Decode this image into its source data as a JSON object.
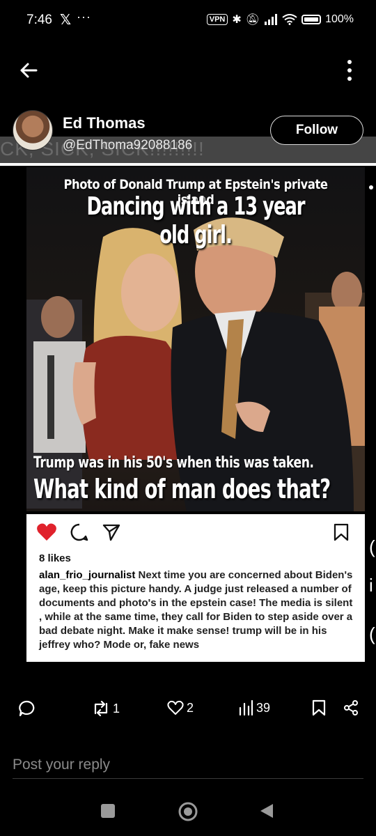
{
  "status_bar": {
    "time": "7:46",
    "notification_icon": "x-logo-icon",
    "overflow": "···",
    "vpn": "VPN",
    "battery": "100%"
  },
  "post": {
    "author_name": "Ed Thomas",
    "author_handle": "@EdThoma92088186",
    "follow_label": "Follow",
    "overlay_caption": "CK, SICK, SICK!!!!!!!!!"
  },
  "image": {
    "headline_small": "Photo of Donald Trump at Epstein's private island",
    "headline_large": "Dancing with a 13 year old girl.",
    "caption_line1": "Trump was in his 50's when this was taken.",
    "caption_line2": "What kind of man does that?"
  },
  "instagram": {
    "likes": "8 likes",
    "username": "alan_frio_journalist",
    "caption": "Next time you are concerned about Biden's age, keep this picture handy. A judge just released a number of documents and photo's in the epstein case!  The media is silent , while  at the same time, they call for Biden to step aside over a bad debate night. Make it make sense! trump will be in his jeffrey who? Mode or, fake news",
    "colors": {
      "heart": "#e0222c"
    }
  },
  "actions": {
    "reposts": "1",
    "likes": "2",
    "views": "39"
  },
  "reply": {
    "placeholder": "Post your reply"
  }
}
